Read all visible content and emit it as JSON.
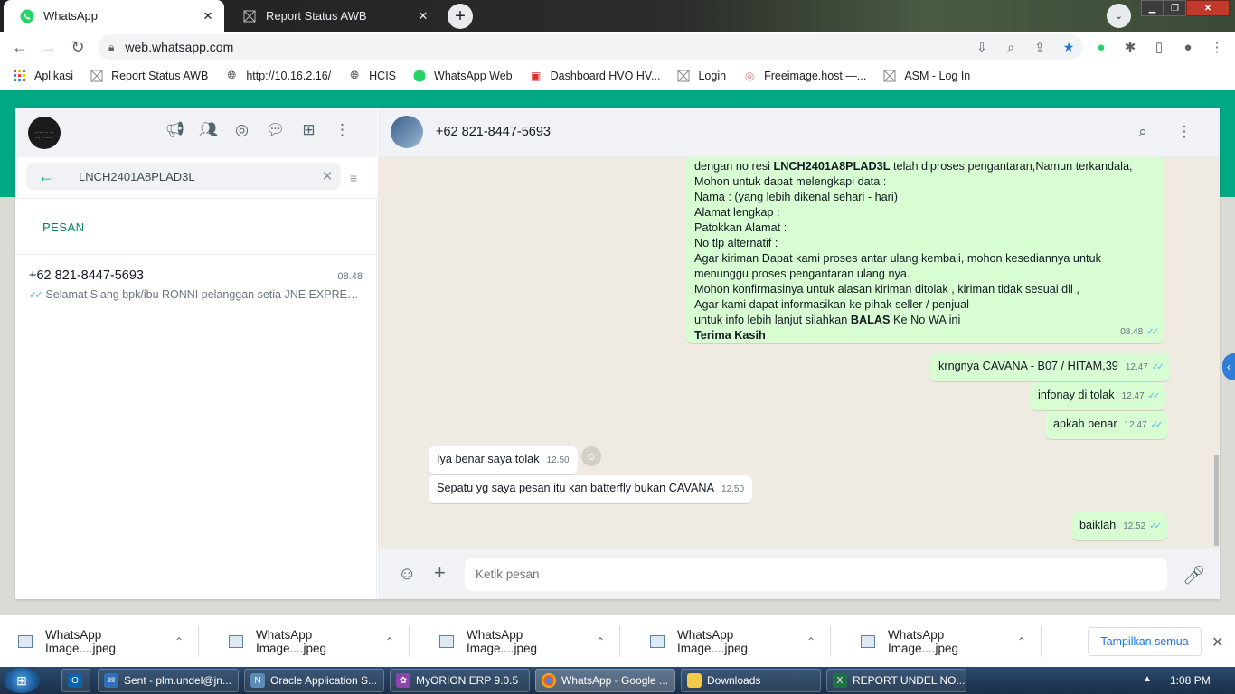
{
  "browser": {
    "tabs": [
      {
        "title": "WhatsApp",
        "active": true
      },
      {
        "title": "Report Status AWB",
        "active": false
      }
    ],
    "url": "web.whatsapp.com",
    "bookmarks": [
      "Aplikasi",
      "Report Status AWB",
      "http://10.16.2.16/",
      "HCIS",
      "WhatsApp Web",
      "Dashboard HVO HV...",
      "Login",
      "Freeimage.host —...",
      "ASM - Log In"
    ]
  },
  "sidebar": {
    "search_value": "LNCH2401A8PLAD3L",
    "section_label": "PESAN",
    "result": {
      "name": "+62 821-8447-5693",
      "time": "08.48",
      "preview": "Selamat Siang   bpk/ibu RONNI pelanggan setia JNE EXPRESS..."
    }
  },
  "chat": {
    "contact": "+62 821-8447-5693",
    "big_message": {
      "pre": "dengan no resi ",
      "resi": "LNCH2401A8PLAD3L",
      "post": " telah diproses pengantaran,Namun terkandala,",
      "lines": [
        "Mohon untuk dapat melengkapi data :",
        "Nama : (yang lebih dikenal sehari - hari)",
        "Alamat  lengkap :",
        "Patokkan Alamat :",
        "No tlp alternatif :",
        "Agar kiriman Dapat kami proses antar ulang kembali, mohon kesediannya untuk",
        "menunggu proses pengantaran ulang nya.",
        "Mohon konfirmasinya untuk alasan kiriman ditolak , kiriman tidak sesuai dll ,",
        " Agar kami dapat informasikan ke pihak seller / penjual"
      ],
      "info_pre": "untuk info lebih lanjut silahkan ",
      "info_bold": "BALAS",
      "info_post": " Ke No WA ini",
      "thanks": "Terima Kasih",
      "time": "08.48"
    },
    "messages": [
      {
        "dir": "out",
        "text": "krngnya CAVANA - B07 / HITAM,39",
        "time": "12.47"
      },
      {
        "dir": "out",
        "text": "infonay di tolak",
        "time": "12.47"
      },
      {
        "dir": "out",
        "text": "apkah benar",
        "time": "12.47"
      },
      {
        "dir": "in",
        "text": "Iya benar saya tolak",
        "time": "12.50"
      },
      {
        "dir": "in",
        "text": "Sepatu yg saya pesan itu kan batterfly bukan CAVANA",
        "time": "12.50"
      },
      {
        "dir": "out",
        "text": "baiklah",
        "time": "12.52"
      }
    ],
    "composer_placeholder": "Ketik pesan"
  },
  "downloads": {
    "items": [
      "WhatsApp Image....jpeg",
      "WhatsApp Image....jpeg",
      "WhatsApp Image....jpeg",
      "WhatsApp Image....jpeg",
      "WhatsApp Image....jpeg"
    ],
    "show_all": "Tampilkan semua"
  },
  "taskbar": {
    "items": [
      "Sent - plm.undel@jn...",
      "Oracle Application S...",
      "MyORION ERP 9.0.5",
      "WhatsApp - Google ...",
      "Downloads",
      "REPORT UNDEL NO..."
    ],
    "clock": "1:08 PM"
  },
  "colors": {
    "wa_green": "#00a884",
    "bubble_out": "#d9fdd3",
    "tick_blue": "#53bdeb"
  }
}
